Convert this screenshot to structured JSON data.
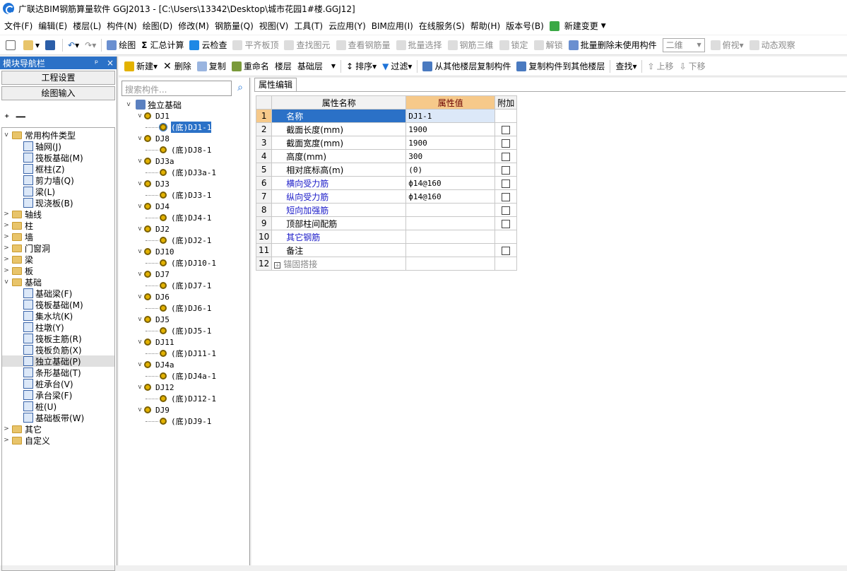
{
  "title": "广联达BIM钢筋算量软件 GGJ2013 - [C:\\Users\\13342\\Desktop\\城市花园1#楼.GGJ12]",
  "menu": [
    "文件(F)",
    "编辑(E)",
    "楼层(L)",
    "构件(N)",
    "绘图(D)",
    "修改(M)",
    "钢筋量(Q)",
    "视图(V)",
    "工具(T)",
    "云应用(Y)",
    "BIM应用(I)",
    "在线服务(S)",
    "帮助(H)",
    "版本号(B)",
    "新建变更"
  ],
  "toolbar1": {
    "draw": "绘图",
    "summary": "汇总计算",
    "cloud_check": "云检查",
    "flat_slab": "平齐板顶",
    "find_elem": "查找图元",
    "view_rebar": "查看钢筋量",
    "batch_select": "批量选择",
    "rebar_3d": "钢筋三维",
    "lock": "锁定",
    "unlock": "解锁",
    "batch_delete": "批量删除未使用构件",
    "view_mode": "二维",
    "top_view": "俯视",
    "dynamic": "动态观察"
  },
  "nav": {
    "header": "模块导航栏",
    "pin": "ᵖ",
    "close": "×",
    "btn_project": "工程设置",
    "btn_draw": "绘图输入",
    "tools": "⁺ 一",
    "tree": [
      {
        "label": "常用构件类型",
        "type": "folder",
        "expanded": true,
        "children": [
          {
            "label": "轴网(J)"
          },
          {
            "label": "筏板基础(M)"
          },
          {
            "label": "框柱(Z)"
          },
          {
            "label": "剪力墙(Q)"
          },
          {
            "label": "梁(L)"
          },
          {
            "label": "现浇板(B)"
          }
        ]
      },
      {
        "label": "轴线",
        "type": "folder"
      },
      {
        "label": "柱",
        "type": "folder"
      },
      {
        "label": "墙",
        "type": "folder"
      },
      {
        "label": "门窗洞",
        "type": "folder"
      },
      {
        "label": "梁",
        "type": "folder"
      },
      {
        "label": "板",
        "type": "folder"
      },
      {
        "label": "基础",
        "type": "folder",
        "expanded": true,
        "children": [
          {
            "label": "基础梁(F)"
          },
          {
            "label": "筏板基础(M)"
          },
          {
            "label": "集水坑(K)"
          },
          {
            "label": "柱墩(Y)"
          },
          {
            "label": "筏板主筋(R)"
          },
          {
            "label": "筏板负筋(X)"
          },
          {
            "label": "独立基础(P)",
            "selected": true
          },
          {
            "label": "条形基础(T)"
          },
          {
            "label": "桩承台(V)"
          },
          {
            "label": "承台梁(F)"
          },
          {
            "label": "桩(U)"
          },
          {
            "label": "基础板带(W)"
          }
        ]
      },
      {
        "label": "其它",
        "type": "folder"
      },
      {
        "label": "自定义",
        "type": "folder"
      }
    ]
  },
  "midtoolbar": {
    "new": "新建",
    "delete": "删除",
    "copy": "复制",
    "rename": "重命名",
    "floor_label": "楼层",
    "floor_value": "基础层",
    "sort": "排序",
    "filter": "过滤",
    "copy_from": "从其他楼层复制构件",
    "copy_to": "复制构件到其他楼层",
    "find": "查找",
    "up": "上移",
    "down": "下移"
  },
  "components": {
    "search_placeholder": "搜索构件...",
    "root": "独立基础",
    "groups": [
      {
        "name": "DJ1",
        "child": "(底)DJ1-1",
        "selected": true
      },
      {
        "name": "DJ8",
        "child": "(底)DJ8-1"
      },
      {
        "name": "DJ3a",
        "child": "(底)DJ3a-1"
      },
      {
        "name": "DJ3",
        "child": "(底)DJ3-1"
      },
      {
        "name": "DJ4",
        "child": "(底)DJ4-1"
      },
      {
        "name": "DJ2",
        "child": "(底)DJ2-1"
      },
      {
        "name": "DJ10",
        "child": "(底)DJ10-1"
      },
      {
        "name": "DJ7",
        "child": "(底)DJ7-1"
      },
      {
        "name": "DJ6",
        "child": "(底)DJ6-1"
      },
      {
        "name": "DJ5",
        "child": "(底)DJ5-1"
      },
      {
        "name": "DJ11",
        "child": "(底)DJ11-1"
      },
      {
        "name": "DJ4a",
        "child": "(底)DJ4a-1"
      },
      {
        "name": "DJ12",
        "child": "(底)DJ12-1"
      },
      {
        "name": "DJ9",
        "child": "(底)DJ9-1"
      }
    ]
  },
  "props": {
    "tab": "属性编辑",
    "headers": {
      "name": "属性名称",
      "value": "属性值",
      "add": "附加"
    },
    "rows": [
      {
        "n": "1",
        "name": "名称",
        "value": "DJ1-1",
        "check": false,
        "blue": false
      },
      {
        "n": "2",
        "name": "截面长度(mm)",
        "value": "1900",
        "check": true
      },
      {
        "n": "3",
        "name": "截面宽度(mm)",
        "value": "1900",
        "check": true
      },
      {
        "n": "4",
        "name": "高度(mm)",
        "value": "300",
        "check": true
      },
      {
        "n": "5",
        "name": "相对底标高(m)",
        "value": "(0)",
        "check": true
      },
      {
        "n": "6",
        "name": "横向受力筋",
        "value": "ф14@160",
        "check": true,
        "blue": true
      },
      {
        "n": "7",
        "name": "纵向受力筋",
        "value": "ф14@160",
        "check": true,
        "blue": true
      },
      {
        "n": "8",
        "name": "短向加强筋",
        "value": "",
        "check": true,
        "blue": true
      },
      {
        "n": "9",
        "name": "顶部柱间配筋",
        "value": "",
        "check": true
      },
      {
        "n": "10",
        "name": "其它钢筋",
        "value": "",
        "check": false,
        "blue": true
      },
      {
        "n": "11",
        "name": "备注",
        "value": "",
        "check": true
      },
      {
        "n": "12",
        "name": "锚固搭接",
        "value": "",
        "check": false,
        "gray": true,
        "plus": true
      }
    ]
  }
}
